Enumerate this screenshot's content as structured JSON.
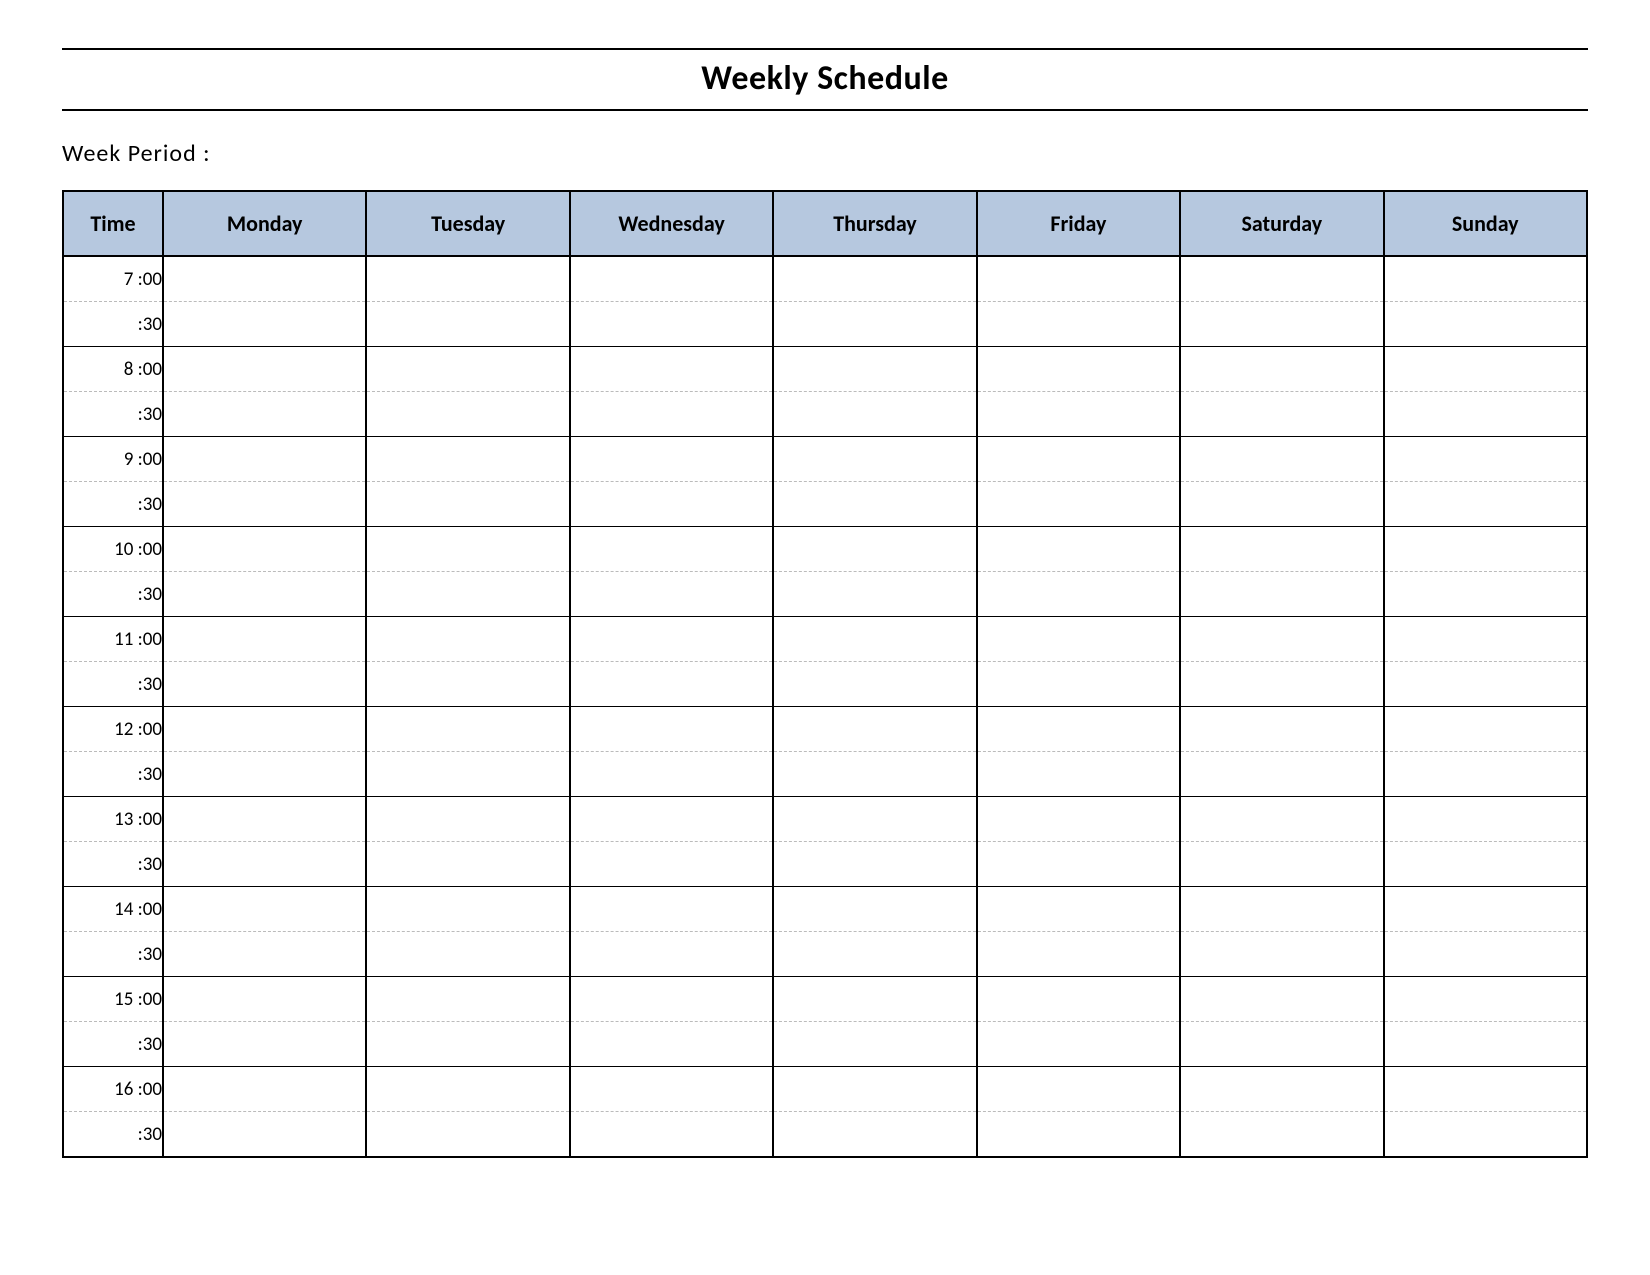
{
  "title": "Weekly Schedule",
  "week_period_label": "Week  Period :",
  "week_period_value": "",
  "headers": {
    "time": "Time",
    "days": [
      "Monday",
      "Tuesday",
      "Wednesday",
      "Thursday",
      "Friday",
      "Saturday",
      "Sunday"
    ]
  },
  "time_slots": [
    "7  :00",
    ":30",
    "8  :00",
    ":30",
    "9  :00",
    ":30",
    "10  :00",
    ":30",
    "11  :00",
    ":30",
    "12  :00",
    ":30",
    "13  :00",
    ":30",
    "14  :00",
    ":30",
    "15  :00",
    ":30",
    "16  :00",
    ":30"
  ],
  "colors": {
    "header_bg": "#b6c8df"
  }
}
